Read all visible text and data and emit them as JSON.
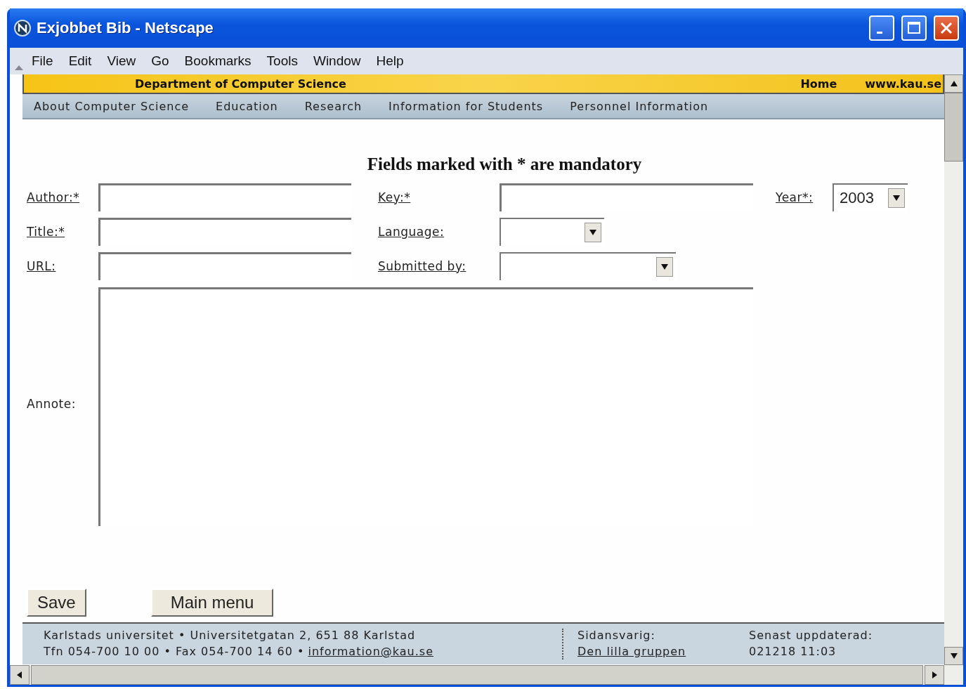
{
  "window": {
    "title": "Exjobbet Bib - Netscape"
  },
  "menu": [
    "File",
    "Edit",
    "View",
    "Go",
    "Bookmarks",
    "Tools",
    "Window",
    "Help"
  ],
  "banner": {
    "title": "Department of Computer Science",
    "links": [
      "Home",
      "www.kau.se"
    ]
  },
  "nav": [
    "About Computer Science",
    "Education",
    "Research",
    "Information for Students",
    "Personnel Information"
  ],
  "form": {
    "heading": "Fields marked with * are mandatory",
    "fields": [
      {
        "label": "Author:*",
        "kind": "text",
        "link": true
      },
      {
        "label": "Key:*",
        "kind": "text",
        "link": true
      },
      {
        "label": "Year*:",
        "kind": "select",
        "link": true,
        "value": "2003"
      },
      {
        "label": "Title:*",
        "kind": "text",
        "link": true
      },
      {
        "label": "Language:",
        "kind": "select",
        "link": true
      },
      {
        "label": "URL:",
        "kind": "text",
        "link": true
      },
      {
        "label": "Submitted by:",
        "kind": "select",
        "link": true
      },
      {
        "label": "Annote:",
        "kind": "textarea",
        "link": false
      }
    ],
    "buttons": [
      "Save",
      "Main menu"
    ]
  },
  "footer": {
    "address": "Karlstads universitet • Universitetgatan 2, 651 88 Karlstad",
    "phone": "Tfn 054-700 10 00 • Fax 054-700 14 60 •",
    "email": "information@kau.se",
    "responsible_label": "Sidansvarig:",
    "responsible": "Den lilla gruppen",
    "updated_label": "Senast uppdaterad:",
    "updated": "021218 11:03"
  }
}
